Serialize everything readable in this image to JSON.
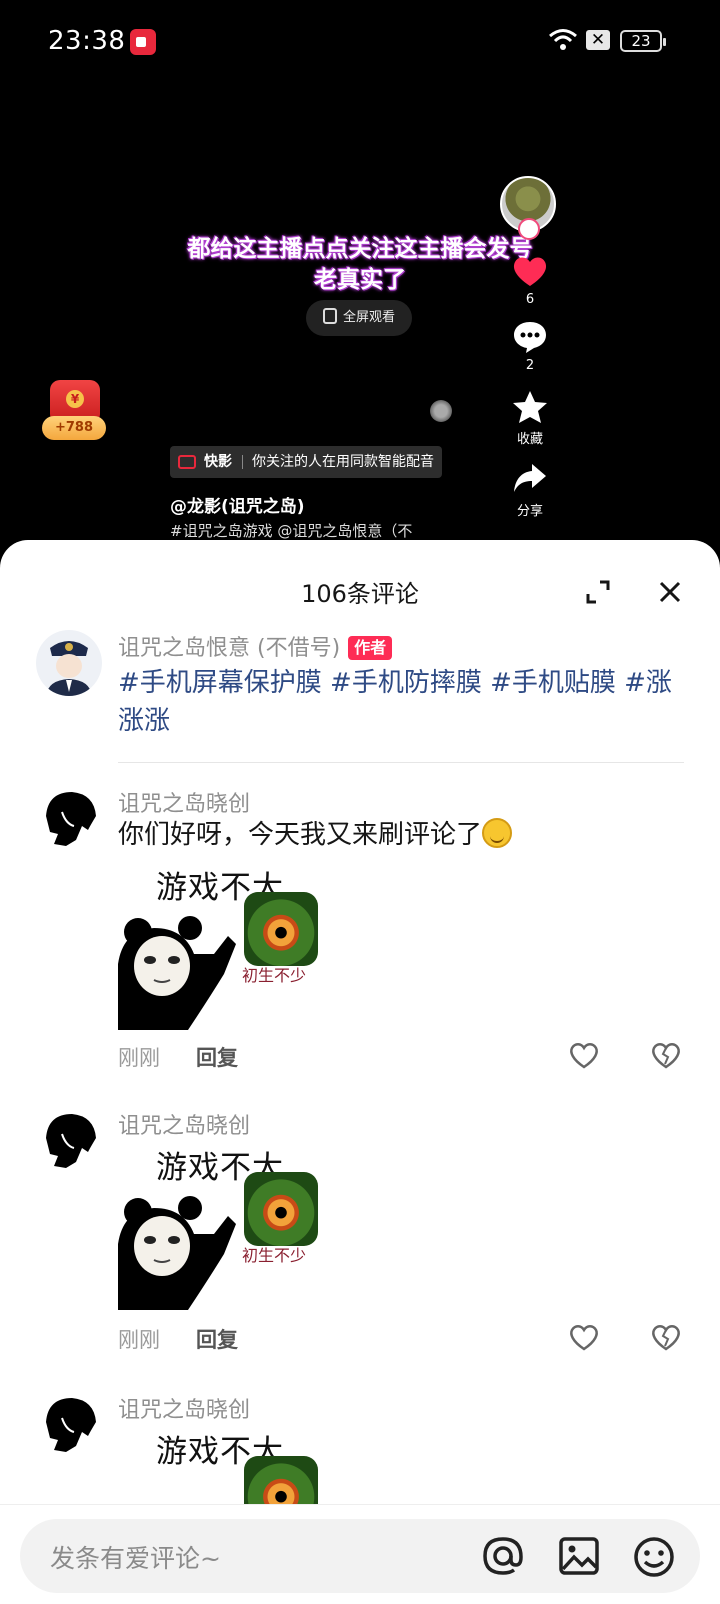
{
  "status_bar": {
    "time": "23:38",
    "battery": "23",
    "sim": "✕"
  },
  "video": {
    "caption": "都给这主播点点关注这主播会发号老真实了",
    "fullscreen_label": "全屏观看",
    "likes": "6",
    "comments": "2",
    "collect_label": "收藏",
    "share_label": "分享",
    "red_packet_amount": "+788",
    "tag_brand": "快影",
    "tag_text": "你关注的人在用同款智能配音",
    "author": "@龙影(诅咒之岛)",
    "description": "#诅咒之岛游戏 @诅咒之岛恨意（不"
  },
  "sheet": {
    "title": "106条评论",
    "comments": [
      {
        "name": "诅咒之岛恨意 (不借号)",
        "badge": "作者",
        "text": "#手机屏幕保护膜 #手机防摔膜 #手机贴膜 #涨涨涨"
      },
      {
        "name": "诅咒之岛晓创",
        "text": "你们好呀，今天我又来刷评论了",
        "meme_title": "游戏不大",
        "meme_sub": "初生不少",
        "time": "刚刚",
        "reply": "回复"
      },
      {
        "name": "诅咒之岛晓创",
        "meme_title": "游戏不大",
        "meme_sub": "初生不少",
        "time": "刚刚",
        "reply": "回复"
      },
      {
        "name": "诅咒之岛晓创",
        "meme_title": "游戏不大"
      }
    ]
  },
  "input": {
    "placeholder": "发条有爱评论~"
  }
}
